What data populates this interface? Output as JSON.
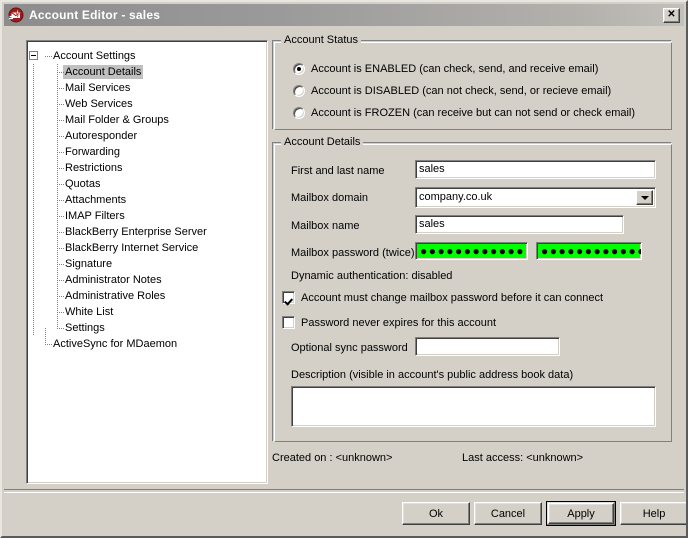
{
  "window": {
    "title": "Account Editor - sales",
    "icon": "mdaemon-app-icon",
    "close_label": "✕"
  },
  "tree": {
    "root": {
      "label": "Account Settings",
      "expander": "collapse-minus"
    },
    "children": [
      {
        "label": "Account Details",
        "selected": true
      },
      {
        "label": "Mail Services",
        "selected": false
      },
      {
        "label": "Web Services",
        "selected": false
      },
      {
        "label": "Mail Folder & Groups",
        "selected": false
      },
      {
        "label": "Autoresponder",
        "selected": false
      },
      {
        "label": "Forwarding",
        "selected": false
      },
      {
        "label": "Restrictions",
        "selected": false
      },
      {
        "label": "Quotas",
        "selected": false
      },
      {
        "label": "Attachments",
        "selected": false
      },
      {
        "label": "IMAP Filters",
        "selected": false
      },
      {
        "label": "BlackBerry Enterprise Server",
        "selected": false
      },
      {
        "label": "BlackBerry Internet Service",
        "selected": false
      },
      {
        "label": "Signature",
        "selected": false
      },
      {
        "label": "Administrator Notes",
        "selected": false
      },
      {
        "label": "Administrative Roles",
        "selected": false
      },
      {
        "label": "White List",
        "selected": false
      },
      {
        "label": "Settings",
        "selected": false
      }
    ],
    "sibling": {
      "label": "ActiveSync for MDaemon"
    }
  },
  "account_status": {
    "legend": "Account Status",
    "options": [
      {
        "label": "Account is ENABLED (can check, send, and receive email)",
        "checked": true
      },
      {
        "label": "Account is DISABLED (can not check, send, or recieve email)",
        "checked": false
      },
      {
        "label": "Account is FROZEN (can receive but can not send or check email)",
        "checked": false
      }
    ]
  },
  "account_details": {
    "legend": "Account Details",
    "first_last_name": {
      "label": "First and last name",
      "value": "sales"
    },
    "mailbox_domain": {
      "label": "Mailbox domain",
      "value": "company.co.uk"
    },
    "mailbox_name": {
      "label": "Mailbox name",
      "value": "sales"
    },
    "mailbox_password": {
      "label": "Mailbox password (twice)",
      "value1": "●●●●●●●●●●●●",
      "value2": "●●●●●●●●●●●●",
      "field_color": "#00ff00"
    },
    "dynamic_auth": "Dynamic authentication: disabled",
    "must_change_password": {
      "label": "Account must change mailbox password before it can connect",
      "checked": true
    },
    "never_expires": {
      "label": "Password never expires for this account",
      "checked": false
    },
    "sync_password": {
      "label": "Optional sync password",
      "value": ""
    },
    "description": {
      "label": "Description (visible in account's public address book data)",
      "value": ""
    }
  },
  "status": {
    "created_on": "Created on : <unknown>",
    "last_access": "Last access: <unknown>"
  },
  "buttons": {
    "ok": "Ok",
    "cancel": "Cancel",
    "apply": "Apply",
    "help": "Help"
  }
}
